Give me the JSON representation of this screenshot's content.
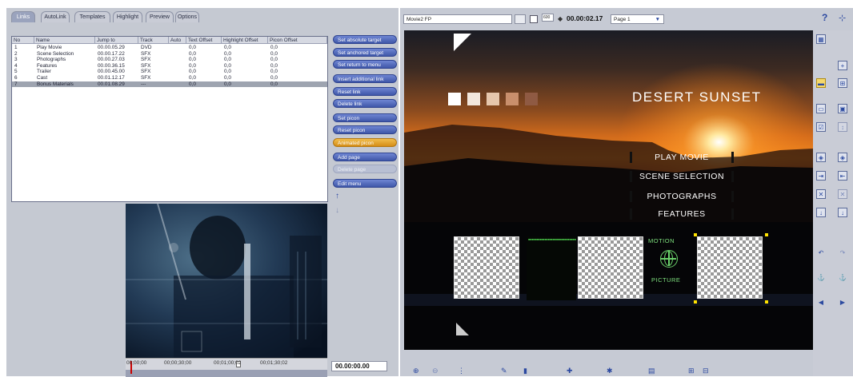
{
  "tabs": [
    "Links",
    "AutoLink",
    "Templates",
    "Highlight",
    "Preview",
    "Options"
  ],
  "links_table": {
    "columns": [
      "No",
      "Name",
      "Jump to",
      "Track",
      "Auto",
      "Text Offset",
      "Highlight Offset",
      "Picon Offset"
    ],
    "rows": [
      [
        "1",
        "Play Movie",
        "00.00.05.29",
        "DVD",
        "",
        "0,0",
        "0,0",
        "0,0"
      ],
      [
        "2",
        "Scene Selection",
        "00.00.17.22",
        "SFX",
        "",
        "0,0",
        "0,0",
        "0,0"
      ],
      [
        "3",
        "Photographs",
        "00.00.27.03",
        "SFX",
        "",
        "0,0",
        "0,0",
        "0,0"
      ],
      [
        "4",
        "Features",
        "00.00.36.15",
        "SFX",
        "",
        "0,0",
        "0,0",
        "0,0"
      ],
      [
        "5",
        "Trailer",
        "00.00.45.00",
        "SFX",
        "",
        "0,0",
        "0,0",
        "0,0"
      ],
      [
        "6",
        "Cast",
        "00.01.12.17",
        "SFX",
        "",
        "0,0",
        "0,0",
        "0,0"
      ],
      [
        "7",
        "Bonus Materials",
        "00.01.08.29",
        "---",
        "",
        "0,0",
        "0,0",
        "0,0"
      ]
    ],
    "selected_row": 6
  },
  "link_buttons": [
    {
      "label": "Set absolute target",
      "style": "blue"
    },
    {
      "label": "Set anchored target",
      "style": "blue"
    },
    {
      "label": "Set return to menu",
      "style": "blue"
    },
    {
      "label": "Insert additional link",
      "style": "blue"
    },
    {
      "label": "Reset link",
      "style": "blue"
    },
    {
      "label": "Delete link",
      "style": "blue"
    },
    {
      "label": "Set picon",
      "style": "blue"
    },
    {
      "label": "Reset picon",
      "style": "blue"
    },
    {
      "label": "Animated picon",
      "style": "orange"
    },
    {
      "label": "Add page",
      "style": "blue"
    },
    {
      "label": "Delete page",
      "style": "gray"
    },
    {
      "label": "Edit menu",
      "style": "blue"
    }
  ],
  "timeline": {
    "ticks": [
      "00;00;00",
      "00;00;30;00",
      "00;01;00;02",
      "00;01;30;02"
    ],
    "timecode": "00.00:00.00"
  },
  "toolbar": {
    "project_name": "Movie2 FP",
    "size_value": "600",
    "timecode": "00.00:02.17",
    "page_select": "Page 1"
  },
  "menu_canvas": {
    "title": "DESERT SUNSET",
    "menu_items": [
      "PLAY MOVIE",
      "SCENE SELECTION",
      "PHOTOGRAPHS",
      "FEATURES"
    ],
    "motion_label": "MOTION",
    "picture_label": "PICTURE"
  },
  "colors": {
    "button_blue": "#4a62b5",
    "button_orange": "#e5a32b",
    "panel_gray": "#c6cad4",
    "selection_gray": "#9ea4b0"
  },
  "icons": {
    "help": "help-icon",
    "connect": "connect-icon"
  }
}
